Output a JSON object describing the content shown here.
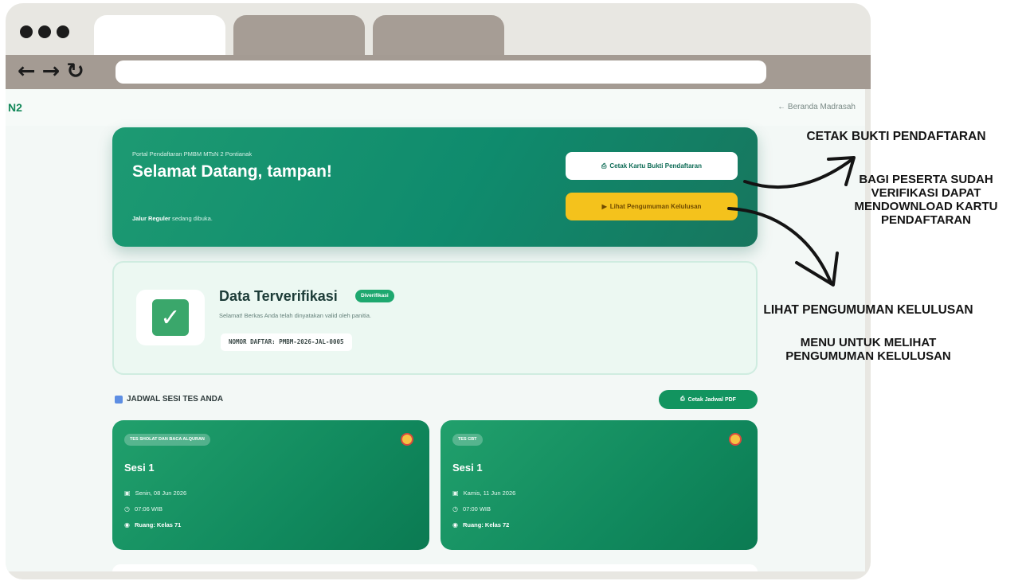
{
  "browser": {
    "nav": {
      "back": "←",
      "forward": "→",
      "reload": "↻"
    }
  },
  "page": {
    "brand": "N2",
    "home_link": "← Beranda Madrasah",
    "hero": {
      "kicker": "Portal Pendaftaran PMBM MTsN 2 Pontianak",
      "title": "Selamat Datang, tampan!",
      "sub_bold": "Jalur Reguler",
      "sub_rest": " sedang dibuka.",
      "print_button": "Cetak Kartu Bukti Pendaftaran",
      "announce_button": "Lihat Pengumuman Kelulusan"
    },
    "verification": {
      "title": "Data Terverifikasi",
      "badge": "Diverifikasi",
      "message": "Selamat! Berkas Anda telah dinyatakan valid oleh panitia.",
      "registration_number": "NOMOR DAFTAR: PMBM-2026-JAL-0005"
    },
    "schedule": {
      "title": "JADWAL SESI TES ANDA",
      "pdf_button": "Cetak Jadwal PDF",
      "cards": [
        {
          "tag": "TES SHOLAT DAN BACA ALQURAN",
          "session": "Sesi 1",
          "date": "Senin, 08 Jun 2026",
          "time": "07:06 WIB",
          "room": "Ruang: Kelas 71"
        },
        {
          "tag": "TES CBT",
          "session": "Sesi 1",
          "date": "Kamis, 11 Jun 2026",
          "time": "07:00 WIB",
          "room": "Ruang: Kelas 72"
        }
      ]
    }
  },
  "annotations": {
    "print_title": "CETAK BUKTI PENDAFTARAN",
    "print_desc": "BAGI PESERTA SUDAH VERIFIKASI DAPAT MENDOWNLOAD KARTU PENDAFTARAN",
    "announce_title": "LIHAT PENGUMUMAN KELULUSAN",
    "announce_desc": "MENU UNTUK MELIHAT PENGUMUMAN KELULUSAN"
  },
  "colors": {
    "primary": "#0f8b6d",
    "accent_yellow": "#f4c21c",
    "badge_green": "#1ea86f"
  }
}
